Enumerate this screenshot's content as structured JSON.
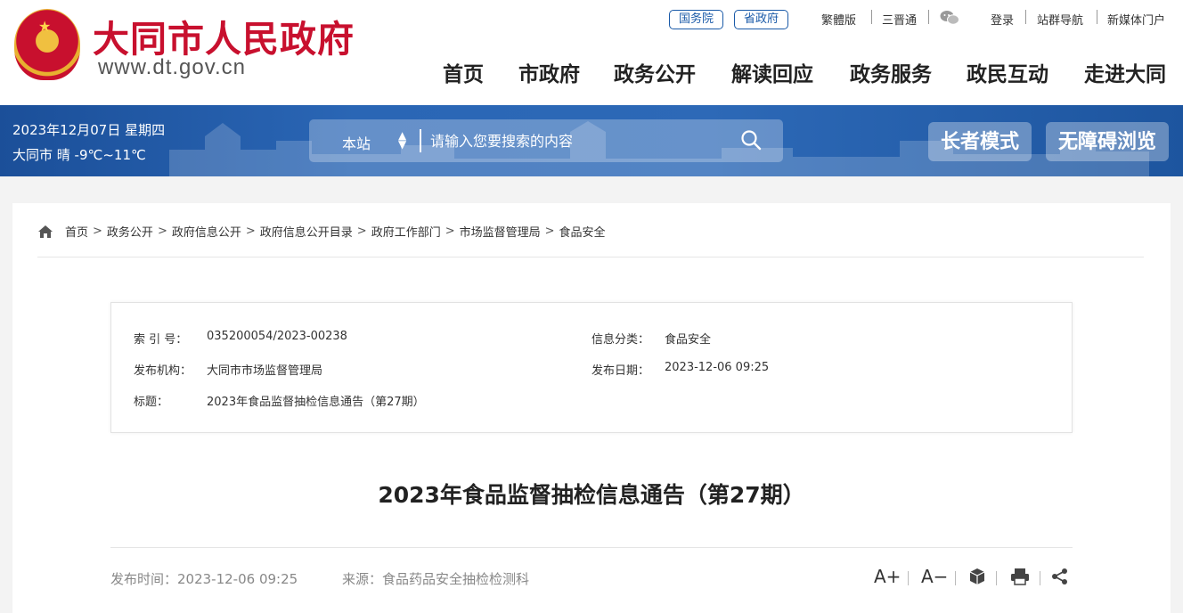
{
  "header": {
    "site_title": "大同市人民政府",
    "site_url": "www.dt.gov.cn",
    "gov_links": [
      "国务院",
      "省政府"
    ],
    "top_links": [
      "繁體版",
      "三晋通",
      "登录",
      "站群导航",
      "新媒体门户"
    ],
    "nav": [
      "首页",
      "市政府",
      "政务公开",
      "解读回应",
      "政务服务",
      "政民互动",
      "走进大同"
    ]
  },
  "banner": {
    "date": "2023年12月07日 星期四",
    "weather": "大同市 晴 -9℃~11℃",
    "search_scope": "本站",
    "search_placeholder": "请输入您要搜索的内容",
    "elder_mode": "长者模式",
    "accessible_mode": "无障碍浏览"
  },
  "breadcrumb": [
    "首页",
    "政务公开",
    "政府信息公开",
    "政府信息公开目录",
    "政府工作部门",
    "市场监督管理局",
    "食品安全"
  ],
  "info": {
    "index_label": "索 引 号：",
    "index_value": "035200054/2023-00238",
    "category_label": "信息分类：",
    "category_value": "食品安全",
    "org_label": "发布机构：",
    "org_value": "大同市市场监督管理局",
    "date_label": "发布日期：",
    "date_value": "2023-12-06 09:25",
    "title_label": "标题：",
    "title_value": "2023年食品监督抽检信息通告（第27期）"
  },
  "article": {
    "title": "2023年食品监督抽检信息通告（第27期）",
    "publish_time": "发布时间：2023-12-06 09:25",
    "source": "来源：食品药品安全抽检检测科",
    "font_larger": "A+",
    "font_smaller": "A−"
  },
  "colors": {
    "brand_red": "#c8102e",
    "banner_blue": "#2a66b5"
  }
}
